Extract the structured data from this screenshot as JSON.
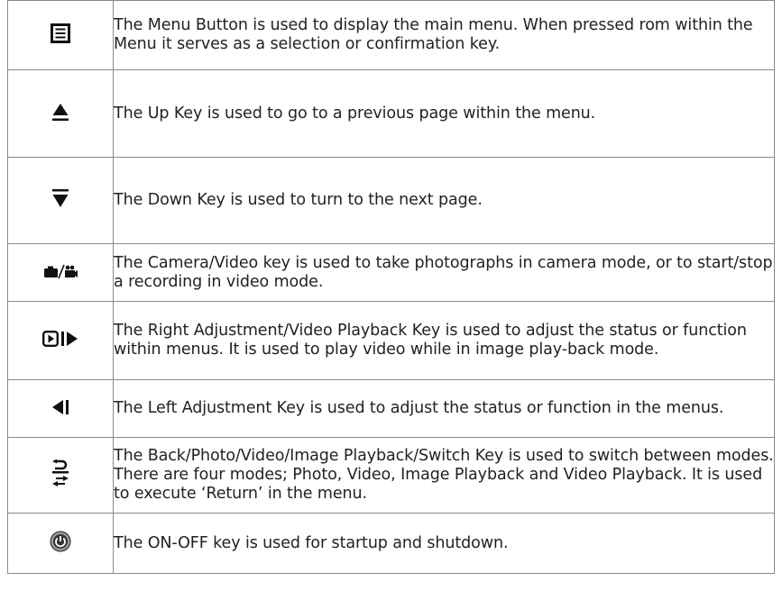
{
  "rows": [
    {
      "icon": "menu-list-icon",
      "description": "The Menu Button  is used to display the main menu. When pressed rom within the Menu it serves as a selection or confirmation key."
    },
    {
      "icon": "up-arrow-icon",
      "description": "The Up Key is used to go to a previous page within the menu."
    },
    {
      "icon": "down-arrow-icon",
      "description": "The Down Key is used to turn to the next page."
    },
    {
      "icon": "camera-video-icon",
      "description": "The Camera/Video key is used to take photographs in camera mode, or to start/stop a recording in video mode."
    },
    {
      "icon": "playback-right-icon",
      "description": "The Right Adjustment/Video Playback Key is used to adjust the status or function within menus. It is used to play video while in image play-back mode."
    },
    {
      "icon": "left-adjust-icon",
      "description": "The Left Adjustment Key  is used to adjust the status or function in the menus."
    },
    {
      "icon": "back-switch-icon",
      "description": "The Back/Photo/Video/Image Playback/Switch Key  is used to switch between modes. There are four modes; Photo, Video, Image Playback and Video Playback. It is used to execute ‘Return’ in the menu."
    },
    {
      "icon": "power-icon",
      "description": "The ON-OFF key  is used for startup and shutdown."
    }
  ]
}
